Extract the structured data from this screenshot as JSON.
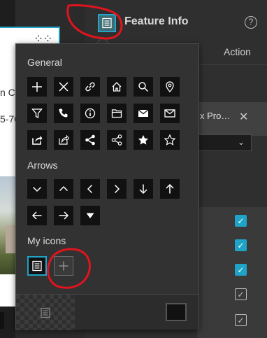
{
  "app": {
    "title": "Feature Info",
    "help_glyph": "?",
    "tab_action": "Action",
    "field_label": "x Pro…",
    "field_close": "✕",
    "dropdown_chevron": "⌄",
    "card_texts": [
      "n C",
      "5-70"
    ]
  },
  "checkboxes": [
    {
      "checked": true
    },
    {
      "checked": true
    },
    {
      "checked": true
    },
    {
      "checked": false
    },
    {
      "checked": false
    }
  ],
  "popover": {
    "sections": [
      {
        "title": "General",
        "icons": [
          "plus-icon",
          "close-icon",
          "link-icon",
          "home-icon",
          "search-icon",
          "location-pin-icon",
          "filter-icon",
          "phone-icon",
          "info-icon",
          "folder-icon",
          "email-filled-icon",
          "email-outline-icon",
          "share-box-filled-icon",
          "share-box-outline-icon",
          "share-nodes-filled-icon",
          "share-nodes-outline-icon",
          "star-filled-icon",
          "star-outline-icon"
        ]
      },
      {
        "title": "Arrows",
        "icons": [
          "chevron-down-icon",
          "chevron-up-icon",
          "chevron-left-icon",
          "chevron-right-icon",
          "arrow-down-icon",
          "arrow-up-icon",
          "arrow-left-icon",
          "arrow-right-icon",
          "caret-down-icon"
        ]
      },
      {
        "title": "My icons",
        "icons": [
          "feature-info-icon",
          "add-icon"
        ]
      }
    ]
  },
  "colors": {
    "accent": "#1fa3c6",
    "annotation": "#e0141e",
    "popover_bg": "#323232",
    "icon_bg": "#111111"
  }
}
